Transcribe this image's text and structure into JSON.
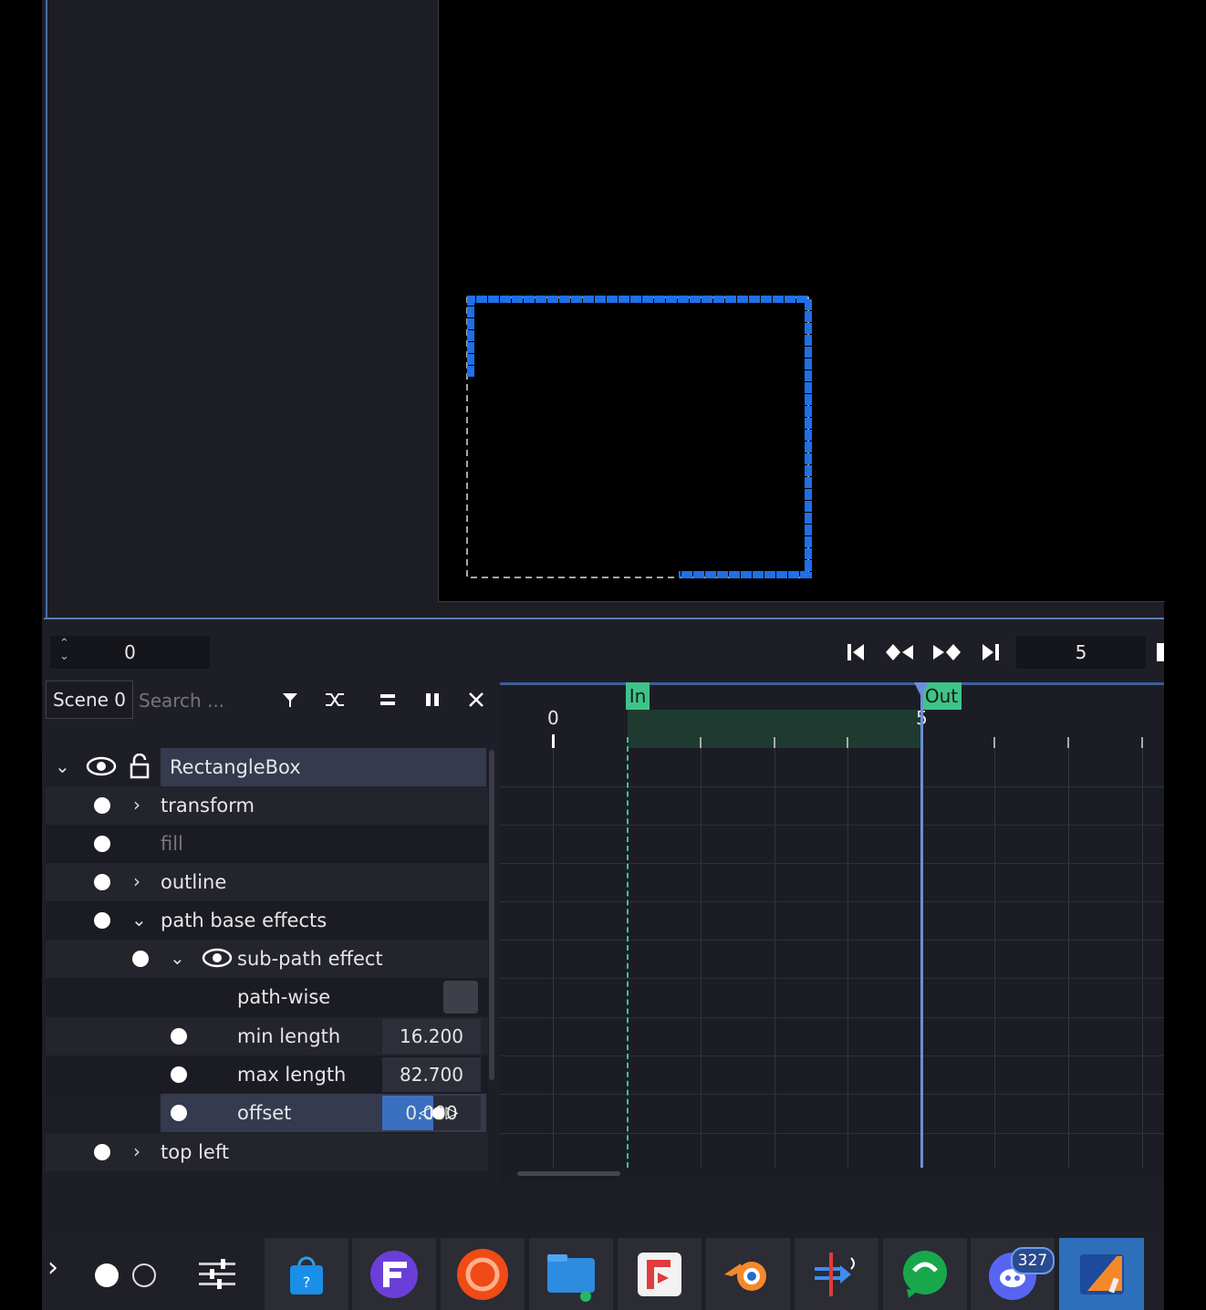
{
  "toolbar": {
    "frame_value": "0",
    "end_value": "5"
  },
  "scene": {
    "tab_label": "Scene 0",
    "search_placeholder": "Search ..."
  },
  "tree": {
    "root_label": "RectangleBox",
    "items": [
      {
        "label": "transform"
      },
      {
        "label": "fill"
      },
      {
        "label": "outline"
      },
      {
        "label": "path base effects"
      },
      {
        "label": "sub-path effect"
      },
      {
        "label": "path-wise"
      },
      {
        "label": "min length",
        "value": "16.200"
      },
      {
        "label": "max length",
        "value": "82.700"
      },
      {
        "label": "offset",
        "value": "0.000"
      },
      {
        "label": "top left"
      }
    ]
  },
  "timeline": {
    "in_label": "In",
    "out_label": "Out",
    "tick_0": "0",
    "tick_5": "5"
  },
  "taskbar": {
    "discord_badge": "327"
  },
  "colors": {
    "accent_blue": "#1f6fe8",
    "in_out_green": "#3ec48a",
    "selection_blue": "#3a6fc0"
  }
}
